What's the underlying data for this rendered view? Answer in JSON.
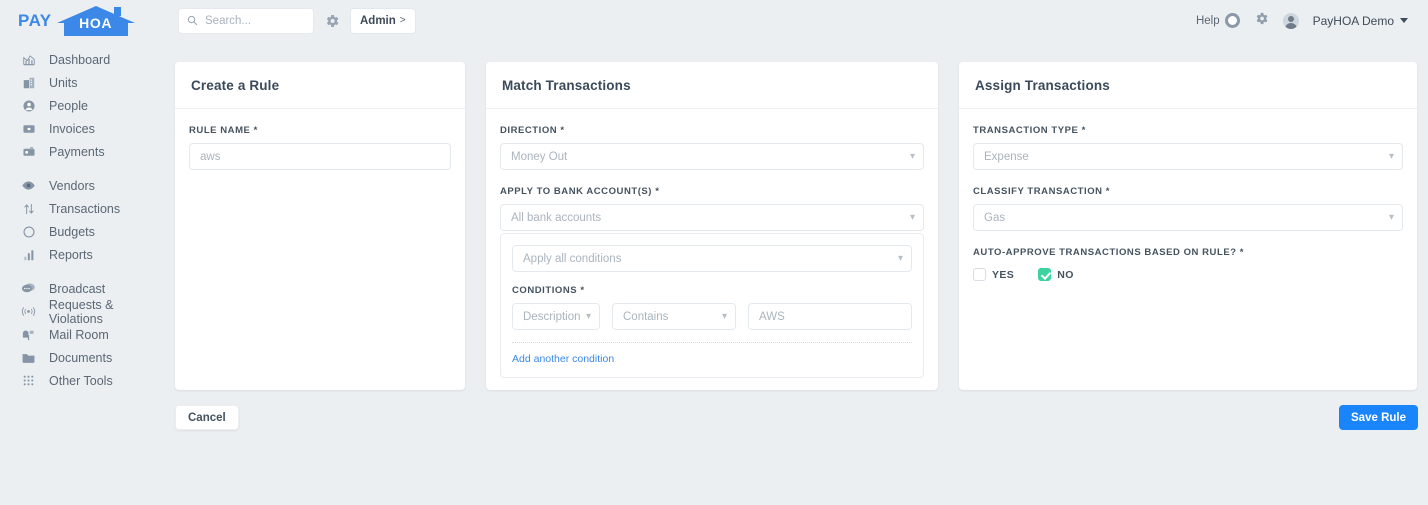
{
  "brand": {
    "pay": "PAY",
    "hoa": "HOA",
    "accent": "#3b88e8"
  },
  "header": {
    "search_placeholder": "Search...",
    "admin_label": "Admin",
    "admin_chevron": ">",
    "help_label": "Help",
    "org_label": "PayHOA Demo"
  },
  "sidebar": {
    "items": [
      {
        "label": "Dashboard",
        "icon": "chart-dashboard-icon"
      },
      {
        "label": "Units",
        "icon": "building-icon"
      },
      {
        "label": "People",
        "icon": "person-circle-icon"
      },
      {
        "label": "Invoices",
        "icon": "invoice-icon"
      },
      {
        "label": "Payments",
        "icon": "payments-icon"
      },
      {
        "label": "Vendors",
        "icon": "eye-vendors-icon"
      },
      {
        "label": "Transactions",
        "icon": "arrows-updown-icon"
      },
      {
        "label": "Budgets",
        "icon": "circle-budgets-icon"
      },
      {
        "label": "Reports",
        "icon": "bar-reports-icon"
      },
      {
        "label": "Broadcast",
        "icon": "speech-bubble-icon"
      },
      {
        "label": "Requests & Violations",
        "icon": "broadcast-signal-icon"
      },
      {
        "label": "Mail Room",
        "icon": "mailbox-icon"
      },
      {
        "label": "Documents",
        "icon": "folder-icon"
      },
      {
        "label": "Other Tools",
        "icon": "grid-dots-icon"
      }
    ]
  },
  "create_rule": {
    "title": "Create a Rule",
    "rule_name_label": "RULE NAME *",
    "rule_name_value": "aws"
  },
  "match_transactions": {
    "title": "Match Transactions",
    "direction_label": "DIRECTION *",
    "direction_value": "Money Out",
    "bank_label": "APPLY TO BANK ACCOUNT(S) *",
    "bank_value": "All bank accounts",
    "apply_conditions_value": "Apply all conditions",
    "conditions_label": "CONDITIONS *",
    "condition_field": "Description",
    "condition_operator": "Contains",
    "condition_value": "AWS",
    "add_condition_label": "Add another condition"
  },
  "assign_transactions": {
    "title": "Assign Transactions",
    "type_label": "TRANSACTION TYPE *",
    "type_value": "Expense",
    "classify_label": "CLASSIFY TRANSACTION *",
    "classify_value": "Gas",
    "auto_approve_label": "AUTO-APPROVE TRANSACTIONS BASED ON RULE? *",
    "yes_label": "YES",
    "no_label": "NO",
    "checked": "NO",
    "check_color": "#3dd3a0"
  },
  "footer": {
    "cancel_label": "Cancel",
    "save_label": "Save Rule",
    "save_color": "#1a85fb"
  }
}
